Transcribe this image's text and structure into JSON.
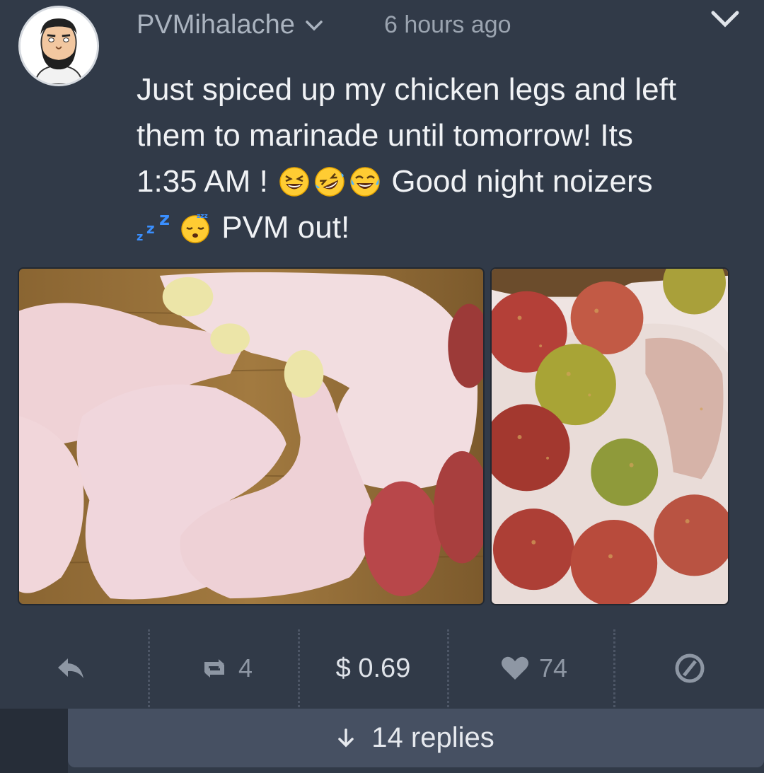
{
  "post": {
    "username": "PVMihalache",
    "timestamp": "6 hours ago",
    "text_line1": "Just spiced up my chicken legs and left",
    "text_line2": "them to marinade until tomorrow! Its",
    "text_line3_a": "1:35 AM ! ",
    "text_line3_b": " Good night noizers",
    "text_line4": " PVM out!",
    "images": [
      "raw-chicken-legs-photo",
      "spiced-chicken-photo"
    ]
  },
  "actions": {
    "repost_count": "4",
    "payout": "$ 0.69",
    "like_count": "74"
  },
  "replies": {
    "label": "14 replies"
  },
  "icons": {
    "reply": "reply-arrow-icon",
    "repost": "repost-icon",
    "like": "heart-icon",
    "flag": "flag-icon",
    "expand": "arrow-down-icon"
  },
  "colors": {
    "background": "#313a48",
    "replies_bar": "#465062",
    "muted_text": "#8e97a4"
  }
}
